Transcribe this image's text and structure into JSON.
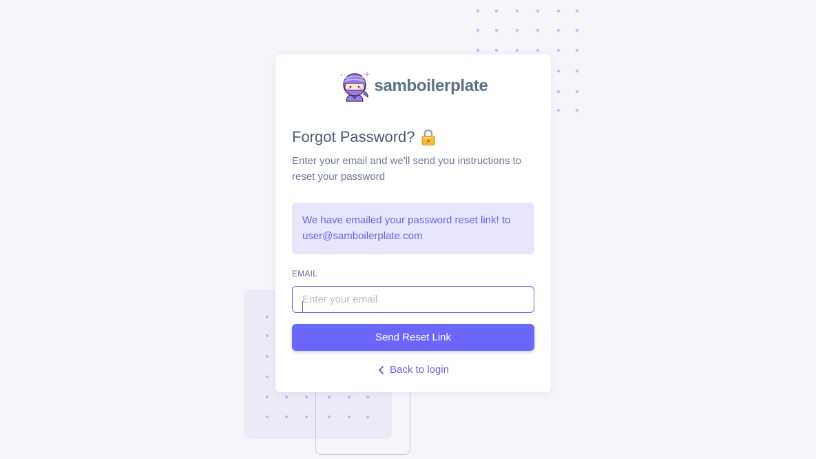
{
  "brand": {
    "name": "samboilerplate",
    "logo_icon": "ninja-mascot-icon"
  },
  "page": {
    "title": "Forgot Password?",
    "title_icon": "lock-icon",
    "subtitle": "Enter your email and we'll send you instructions to reset your password"
  },
  "alert": {
    "message": "We have emailed your password reset link! to user@samboilerplate.com"
  },
  "form": {
    "email_label": "EMAIL",
    "email_value": "",
    "email_placeholder": "Enter your email",
    "submit_label": "Send Reset Link"
  },
  "footer": {
    "back_label": "Back to login",
    "back_icon": "chevron-left-icon"
  },
  "colors": {
    "primary": "#6B67FB",
    "background": "#F4F4F9",
    "alert_background": "#E7E6FD",
    "text_muted": "#6B7891"
  }
}
